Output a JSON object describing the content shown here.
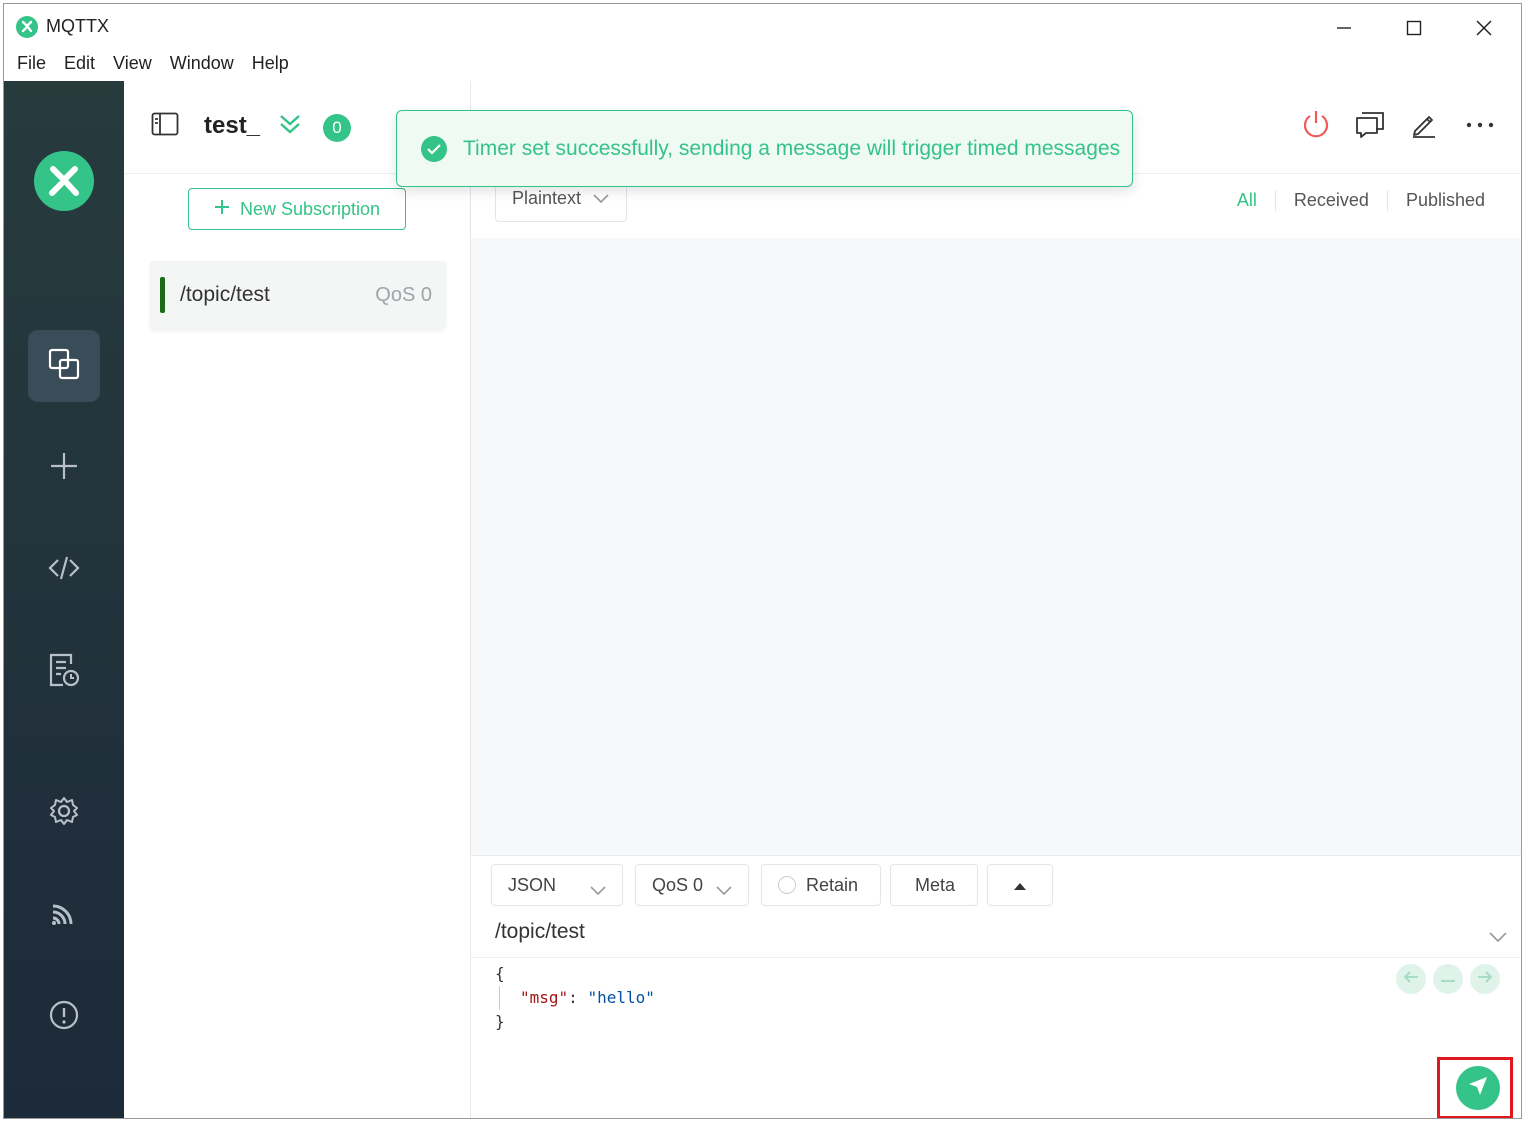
{
  "window": {
    "title": "MQTTX"
  },
  "menu": [
    "File",
    "Edit",
    "View",
    "Window",
    "Help"
  ],
  "connection": {
    "name": "test_",
    "count": "0"
  },
  "toast": {
    "message": "Timer set successfully, sending a message will trigger timed messages"
  },
  "subscriptions": {
    "new_label": "New Subscription",
    "items": [
      {
        "topic": "/topic/test",
        "qos": "QoS 0",
        "color": "#1b6b16"
      }
    ]
  },
  "messages": {
    "format": "Plaintext",
    "tabs": [
      "All",
      "Received",
      "Published"
    ]
  },
  "composer": {
    "format": "JSON",
    "qos": "QoS 0",
    "retain_label": "Retain",
    "meta_label": "Meta",
    "topic": "/topic/test",
    "payload": {
      "open": "{",
      "key": "\"msg\"",
      "colon": ": ",
      "value": "\"hello\"",
      "close": "}"
    }
  },
  "colors": {
    "accent": "#34c388",
    "sidebar": "#233240",
    "highlight": "#e2161f"
  },
  "icons": [
    "mqttx-logo-icon",
    "connections-icon",
    "plus-icon",
    "script-icon",
    "log-icon",
    "gear-icon",
    "feed-icon",
    "info-icon",
    "power-icon",
    "chat-icon",
    "edit-icon",
    "more-icon",
    "send-icon"
  ]
}
